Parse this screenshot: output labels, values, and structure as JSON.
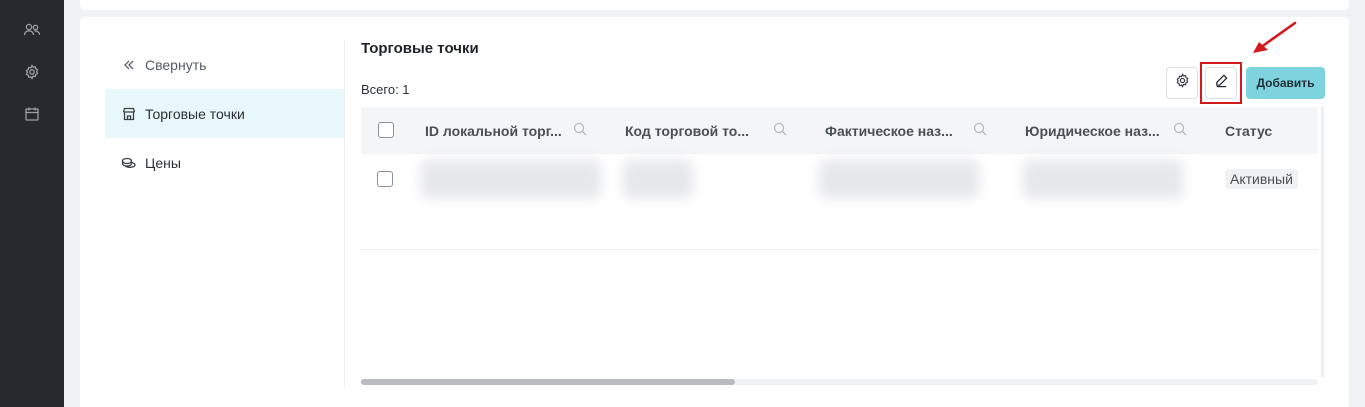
{
  "rail": {
    "icons": [
      "users-icon",
      "gear-icon",
      "calendar-icon"
    ]
  },
  "side_nav": {
    "collapse_label": "Свернуть",
    "items": [
      {
        "label": "Торговые точки",
        "icon": "store-icon",
        "active": true
      },
      {
        "label": "Цены",
        "icon": "coins-icon",
        "active": false
      }
    ]
  },
  "page": {
    "title": "Торговые точки",
    "total": "Всего: 1"
  },
  "toolbar": {
    "settings_icon": "gear-icon",
    "edit_icon": "pencil-icon",
    "add_label": "Добавить"
  },
  "colors": {
    "accent": "#7ed3de",
    "active_nav_bg": "#e8f7f9",
    "highlight": "#d2191c",
    "rail_bg": "#27292e"
  },
  "table": {
    "columns": [
      "ID локальной торг...",
      "Код торговой то...",
      "Фактическое наз...",
      "Юридическое наз...",
      "Статус"
    ],
    "rows": [
      {
        "status": "Активный"
      }
    ]
  }
}
